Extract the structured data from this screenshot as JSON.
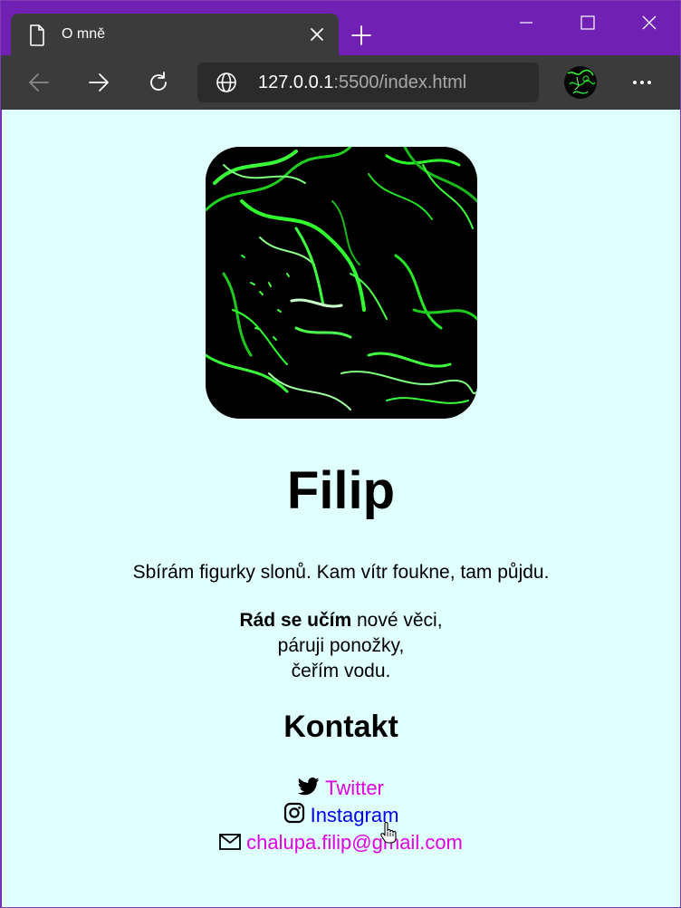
{
  "browser": {
    "tab_title": "O mně",
    "url_host": "127.0.0.1",
    "url_rest": ":5500/index.html",
    "icons": {
      "tab": "page-icon",
      "close": "close-icon",
      "new_tab": "plus-icon",
      "back": "back-arrow-icon",
      "forward": "forward-arrow-icon",
      "reload": "reload-icon",
      "site_info": "globe-icon",
      "profile": "profile-avatar",
      "menu": "more-icon"
    }
  },
  "page": {
    "background": "#e0ffff",
    "name": "Filip",
    "tagline": "Sbírám figurky slonů. Kam vítr foukne, tam půjdu.",
    "bio": {
      "bold": "Rád se učím",
      "line1_rest": "nové věci,",
      "line2": "páruji ponožky,",
      "line3": "čeřím vodu."
    },
    "contact_heading": "Kontakt",
    "contacts": [
      {
        "icon": "twitter-icon",
        "label": "Twitter",
        "color": "#e100e1"
      },
      {
        "icon": "instagram-icon",
        "label": "Instagram",
        "color": "#0000ee"
      },
      {
        "icon": "envelope-icon",
        "label": "chalupa.filip@gmail.com",
        "color": "#e100e1"
      }
    ]
  },
  "colors": {
    "titlebar": "#7120b4",
    "toolbar": "#3b3b3b",
    "address_bar": "#2b2b2b",
    "link_visited": "#e100e1",
    "link_unvisited": "#0000ee"
  }
}
